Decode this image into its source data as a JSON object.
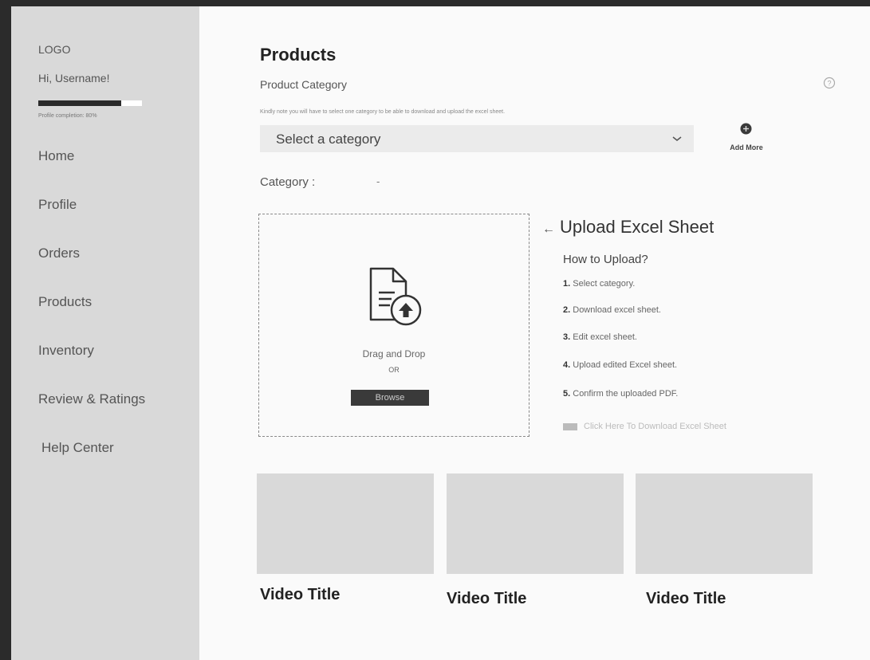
{
  "sidebar": {
    "logo": "LOGO",
    "greeting": "Hi, Username!",
    "profile_completion": {
      "text": "Profile completion: 80%",
      "percent": 80
    },
    "nav": [
      {
        "label": "Home"
      },
      {
        "label": "Profile"
      },
      {
        "label": "Orders"
      },
      {
        "label": "Products"
      },
      {
        "label": "Inventory"
      },
      {
        "label": "Review & Ratings"
      },
      {
        "label": "Help Center"
      }
    ]
  },
  "main": {
    "title": "Products",
    "category_heading": "Product Category",
    "category_note": "Kindly note you will have to select one category to be able to download and upload the excel sheet.",
    "select": {
      "placeholder": "Select a category"
    },
    "add_more_label": "Add More",
    "category_label": "Category :",
    "category_value": "-",
    "dropzone": {
      "line1": "Drag and Drop",
      "line2": "OR",
      "browse_label": "Browse"
    },
    "upload": {
      "title": "Upload Excel Sheet",
      "arrow": "←",
      "howto": "How to Upload?",
      "steps": [
        {
          "num": "1.",
          "text": "Select category."
        },
        {
          "num": "2.",
          "text": "Download excel sheet."
        },
        {
          "num": "3.",
          "text": "Edit excel sheet."
        },
        {
          "num": "4.",
          "text": "Upload edited Excel sheet."
        },
        {
          "num": "5.",
          "text": "Confirm the uploaded PDF."
        }
      ],
      "download_link": "Click Here To Download Excel Sheet"
    },
    "videos": [
      {
        "title": "Video Title"
      },
      {
        "title": "Video Title"
      },
      {
        "title": "Video Title"
      }
    ]
  },
  "icons": {
    "help": "help-circle-icon",
    "add_more": "plus-circle-icon",
    "select": "chevron-down-icon",
    "file": "file-upload-icon",
    "download": "excel-file-icon"
  }
}
